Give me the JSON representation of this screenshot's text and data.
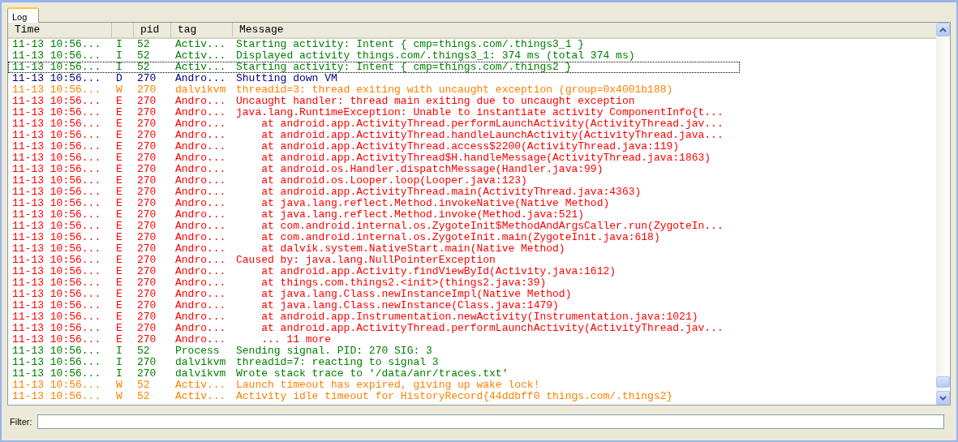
{
  "tabs": [
    {
      "label": "Log",
      "selected": true
    }
  ],
  "table": {
    "columns": [
      "Time",
      "",
      "pid",
      "tag",
      "Message"
    ],
    "rows": [
      {
        "time": "11-13 10:56...",
        "priority": "I",
        "pid": "52",
        "tag": "Activ...",
        "message": "Starting activity: Intent { cmp=things.com/.things3_1 }",
        "selected": false
      },
      {
        "time": "11-13 10:56...",
        "priority": "I",
        "pid": "52",
        "tag": "Activ...",
        "message": "Displayed activity things.com/.things3_1: 374 ms (total 374 ms)",
        "selected": false
      },
      {
        "time": "11-13 10:56...",
        "priority": "I",
        "pid": "52",
        "tag": "Activ...",
        "message": "Starting activity: Intent { cmp=things.com/.things2 }",
        "selected": true
      },
      {
        "time": "11-13 10:56...",
        "priority": "D",
        "pid": "270",
        "tag": "Andro...",
        "message": "Shutting down VM",
        "selected": false
      },
      {
        "time": "11-13 10:56...",
        "priority": "W",
        "pid": "270",
        "tag": "dalvikvm",
        "message": "threadid=3: thread exiting with uncaught exception (group=0x4001b188)",
        "selected": false
      },
      {
        "time": "11-13 10:56...",
        "priority": "E",
        "pid": "270",
        "tag": "Andro...",
        "message": "Uncaught handler: thread main exiting due to uncaught exception",
        "selected": false
      },
      {
        "time": "11-13 10:56...",
        "priority": "E",
        "pid": "270",
        "tag": "Andro...",
        "message": "java.lang.RuntimeException: Unable to instantiate activity ComponentInfo{t...",
        "selected": false
      },
      {
        "time": "11-13 10:56...",
        "priority": "E",
        "pid": "270",
        "tag": "Andro...",
        "message": "    at android.app.ActivityThread.performLaunchActivity(ActivityThread.jav...",
        "selected": false
      },
      {
        "time": "11-13 10:56...",
        "priority": "E",
        "pid": "270",
        "tag": "Andro...",
        "message": "    at android.app.ActivityThread.handleLaunchActivity(ActivityThread.java...",
        "selected": false
      },
      {
        "time": "11-13 10:56...",
        "priority": "E",
        "pid": "270",
        "tag": "Andro...",
        "message": "    at android.app.ActivityThread.access$2200(ActivityThread.java:119)",
        "selected": false
      },
      {
        "time": "11-13 10:56...",
        "priority": "E",
        "pid": "270",
        "tag": "Andro...",
        "message": "    at android.app.ActivityThread$H.handleMessage(ActivityThread.java:1863)",
        "selected": false
      },
      {
        "time": "11-13 10:56...",
        "priority": "E",
        "pid": "270",
        "tag": "Andro...",
        "message": "    at android.os.Handler.dispatchMessage(Handler.java:99)",
        "selected": false
      },
      {
        "time": "11-13 10:56...",
        "priority": "E",
        "pid": "270",
        "tag": "Andro...",
        "message": "    at android.os.Looper.loop(Looper.java:123)",
        "selected": false
      },
      {
        "time": "11-13 10:56...",
        "priority": "E",
        "pid": "270",
        "tag": "Andro...",
        "message": "    at android.app.ActivityThread.main(ActivityThread.java:4363)",
        "selected": false
      },
      {
        "time": "11-13 10:56...",
        "priority": "E",
        "pid": "270",
        "tag": "Andro...",
        "message": "    at java.lang.reflect.Method.invokeNative(Native Method)",
        "selected": false
      },
      {
        "time": "11-13 10:56...",
        "priority": "E",
        "pid": "270",
        "tag": "Andro...",
        "message": "    at java.lang.reflect.Method.invoke(Method.java:521)",
        "selected": false
      },
      {
        "time": "11-13 10:56...",
        "priority": "E",
        "pid": "270",
        "tag": "Andro...",
        "message": "    at com.android.internal.os.ZygoteInit$MethodAndArgsCaller.run(ZygoteIn...",
        "selected": false
      },
      {
        "time": "11-13 10:56...",
        "priority": "E",
        "pid": "270",
        "tag": "Andro...",
        "message": "    at com.android.internal.os.ZygoteInit.main(ZygoteInit.java:618)",
        "selected": false
      },
      {
        "time": "11-13 10:56...",
        "priority": "E",
        "pid": "270",
        "tag": "Andro...",
        "message": "    at dalvik.system.NativeStart.main(Native Method)",
        "selected": false
      },
      {
        "time": "11-13 10:56...",
        "priority": "E",
        "pid": "270",
        "tag": "Andro...",
        "message": "Caused by: java.lang.NullPointerException",
        "selected": false
      },
      {
        "time": "11-13 10:56...",
        "priority": "E",
        "pid": "270",
        "tag": "Andro...",
        "message": "    at android.app.Activity.findViewById(Activity.java:1612)",
        "selected": false
      },
      {
        "time": "11-13 10:56...",
        "priority": "E",
        "pid": "270",
        "tag": "Andro...",
        "message": "    at things.com.things2.<init>(things2.java:39)",
        "selected": false
      },
      {
        "time": "11-13 10:56...",
        "priority": "E",
        "pid": "270",
        "tag": "Andro...",
        "message": "    at java.lang.Class.newInstanceImpl(Native Method)",
        "selected": false
      },
      {
        "time": "11-13 10:56...",
        "priority": "E",
        "pid": "270",
        "tag": "Andro...",
        "message": "    at java.lang.Class.newInstance(Class.java:1479)",
        "selected": false
      },
      {
        "time": "11-13 10:56...",
        "priority": "E",
        "pid": "270",
        "tag": "Andro...",
        "message": "    at android.app.Instrumentation.newActivity(Instrumentation.java:1021)",
        "selected": false
      },
      {
        "time": "11-13 10:56...",
        "priority": "E",
        "pid": "270",
        "tag": "Andro...",
        "message": "    at android.app.ActivityThread.performLaunchActivity(ActivityThread.jav...",
        "selected": false
      },
      {
        "time": "11-13 10:56...",
        "priority": "E",
        "pid": "270",
        "tag": "Andro...",
        "message": "    ... 11 more",
        "selected": false
      },
      {
        "time": "11-13 10:56...",
        "priority": "I",
        "pid": "52",
        "tag": "Process",
        "message": "Sending signal. PID: 270 SIG: 3",
        "selected": false
      },
      {
        "time": "11-13 10:56...",
        "priority": "I",
        "pid": "270",
        "tag": "dalvikvm",
        "message": "threadid=7: reacting to signal 3",
        "selected": false
      },
      {
        "time": "11-13 10:56...",
        "priority": "I",
        "pid": "270",
        "tag": "dalvikvm",
        "message": "Wrote stack trace to '/data/anr/traces.txt'",
        "selected": false
      },
      {
        "time": "11-13 10:56...",
        "priority": "W",
        "pid": "52",
        "tag": "Activ...",
        "message": "Launch timeout has expired, giving up wake lock!",
        "selected": false
      },
      {
        "time": "11-13 10:56...",
        "priority": "W",
        "pid": "52",
        "tag": "Activ...",
        "message": "Activity idle timeout for HistoryRecord{44ddbff0 things.com/.things2}",
        "selected": false
      }
    ]
  },
  "filter": {
    "label": "Filter:"
  }
}
